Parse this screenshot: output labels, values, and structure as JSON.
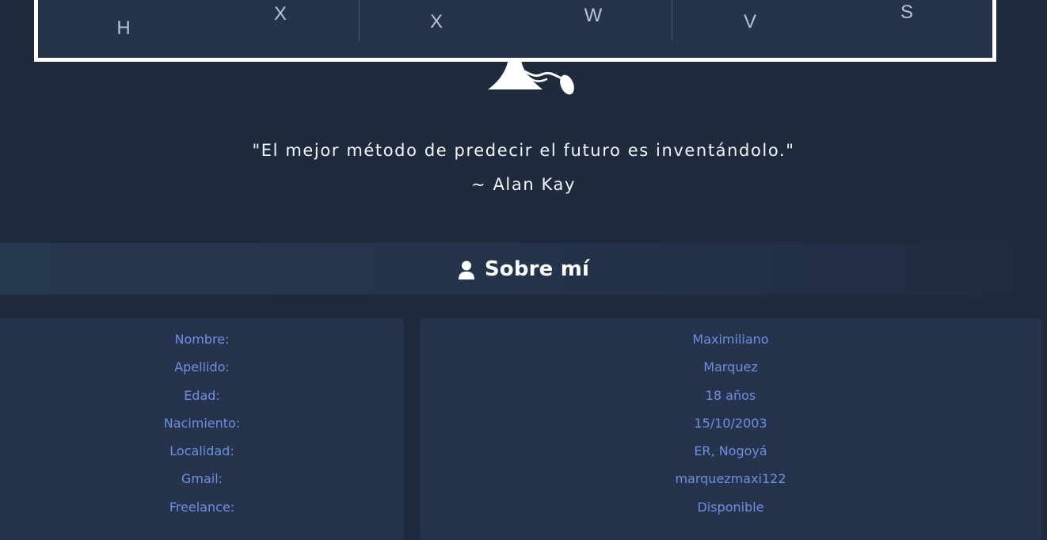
{
  "keyboard": {
    "keys": [
      {
        "letter": "H"
      },
      {
        "letter": "X"
      },
      {
        "letter": "X"
      },
      {
        "letter": "W"
      },
      {
        "letter": "V"
      },
      {
        "letter": "S"
      }
    ]
  },
  "quote": {
    "text": "\"El mejor método de predecir el futuro es inventándolo.\"",
    "author": "~ Alan Kay"
  },
  "about": {
    "title": "Sobre mí",
    "icon": "user-icon",
    "labels": [
      "Nombre:",
      "Apellido:",
      "Edad:",
      "Nacimiento:",
      "Localidad:",
      "Gmail:",
      "Freelance:"
    ],
    "values": [
      "Maximiliano",
      "Marquez",
      "18 años",
      "15/10/2003",
      "ER, Nogoyá",
      "marquezmaxi122",
      "Disponible"
    ]
  },
  "colors": {
    "background": "#1f2a3d",
    "card": "#25344c",
    "accent_text": "#6f8fe0",
    "quote_text": "#f4f6fa"
  }
}
